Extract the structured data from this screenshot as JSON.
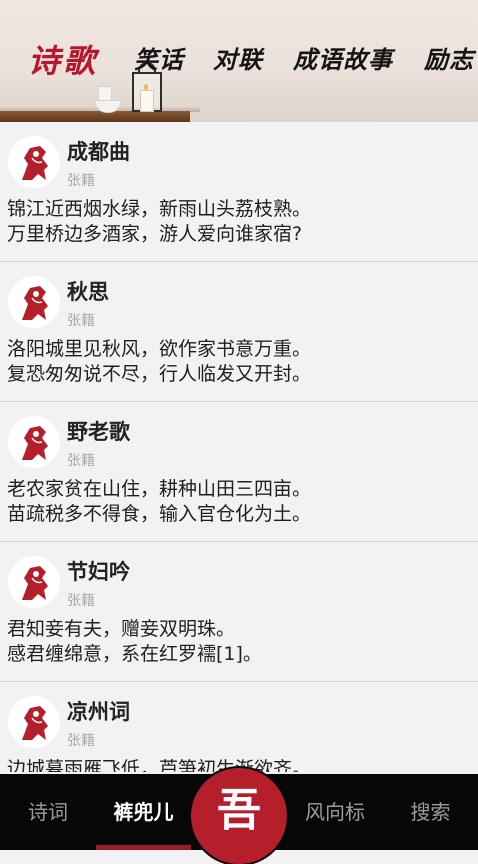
{
  "header": {
    "tabs": [
      {
        "label": "诗歌",
        "active": true
      },
      {
        "label": "笑话"
      },
      {
        "label": "对联"
      },
      {
        "label": "成语故事"
      },
      {
        "label": "励志"
      }
    ]
  },
  "poems": [
    {
      "title": "成都曲",
      "author": "张籍",
      "line1": "锦江近西烟水绿，新雨山头荔枝熟。",
      "line2": "万里桥边多酒家，游人爱向谁家宿?"
    },
    {
      "title": "秋思",
      "author": "张籍",
      "line1": "洛阳城里见秋风，欲作家书意万重。",
      "line2": "复恐匆匆说不尽，行人临发又开封。"
    },
    {
      "title": "野老歌",
      "author": "张籍",
      "line1": "老农家贫在山住，耕种山田三四亩。",
      "line2": "苗疏税多不得食，输入官仓化为土。"
    },
    {
      "title": "节妇吟",
      "author": "张籍",
      "line1": "君知妾有夫，赠妾双明珠。",
      "line2": "感君缠绵意，系在红罗襦[1]。"
    },
    {
      "title": "凉州词",
      "author": "张籍",
      "line1": "边城暮雨雁飞低，芦笋初生渐欲齐。",
      "line2": ""
    }
  ],
  "bottom_nav": {
    "items": [
      {
        "label": "诗词"
      },
      {
        "label": "裤兜儿",
        "active": true
      },
      {
        "label": "风向标"
      },
      {
        "label": "搜索"
      }
    ],
    "center_glyph": "吾"
  },
  "colors": {
    "accent": "#b51f2c",
    "nav_bg": "#070707",
    "list_bg": "#f2f2f4"
  }
}
